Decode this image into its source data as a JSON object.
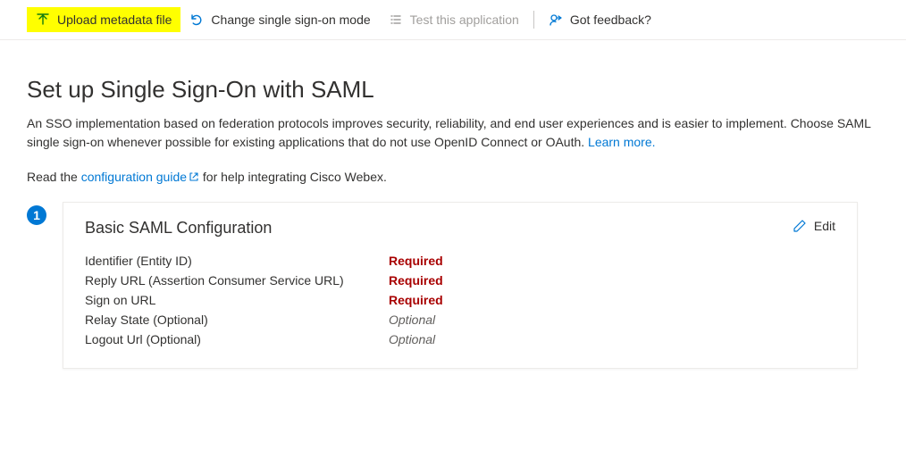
{
  "toolbar": {
    "upload": "Upload metadata file",
    "change_mode": "Change single sign-on mode",
    "test_app": "Test this application",
    "feedback": "Got feedback?"
  },
  "page": {
    "title": "Set up Single Sign-On with SAML",
    "desc_prefix": "An SSO implementation based on federation protocols improves security, reliability, and end user experiences and is easier to implement. Choose SAML single sign-on whenever possible for existing applications that do not use OpenID Connect or OAuth. ",
    "learn_more": "Learn more.",
    "guide_prefix": "Read the ",
    "guide_link": "configuration guide",
    "guide_suffix": " for help integrating Cisco Webex."
  },
  "step": {
    "number": "1",
    "card_title": "Basic SAML Configuration",
    "edit": "Edit",
    "fields": [
      {
        "label": "Identifier (Entity ID)",
        "value": "Required",
        "kind": "required"
      },
      {
        "label": "Reply URL (Assertion Consumer Service URL)",
        "value": "Required",
        "kind": "required"
      },
      {
        "label": "Sign on URL",
        "value": "Required",
        "kind": "required"
      },
      {
        "label": "Relay State (Optional)",
        "value": "Optional",
        "kind": "optional"
      },
      {
        "label": "Logout Url (Optional)",
        "value": "Optional",
        "kind": "optional"
      }
    ]
  }
}
